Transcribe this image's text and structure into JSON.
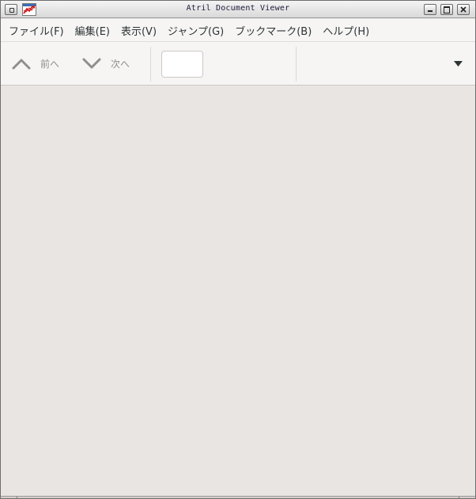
{
  "window": {
    "title": "Atril Document Viewer"
  },
  "menubar": {
    "items": [
      {
        "label": "ファイル(F)"
      },
      {
        "label": "編集(E)"
      },
      {
        "label": "表示(V)"
      },
      {
        "label": "ジャンプ(G)"
      },
      {
        "label": "ブックマーク(B)"
      },
      {
        "label": "ヘルプ(H)"
      }
    ]
  },
  "toolbar": {
    "prev_label": "前へ",
    "next_label": "次へ",
    "prev_icon": "chevron-up-icon",
    "next_icon": "chevron-down-icon",
    "page_entry_value": "",
    "menu_icon": "triangle-down-icon"
  },
  "colors": {
    "titlebar_text": "#1a1a3a",
    "menubar_bg": "#f6f5f4",
    "doc_bg": "#e8e5e2",
    "nav_icon": "#8e8e8e"
  }
}
